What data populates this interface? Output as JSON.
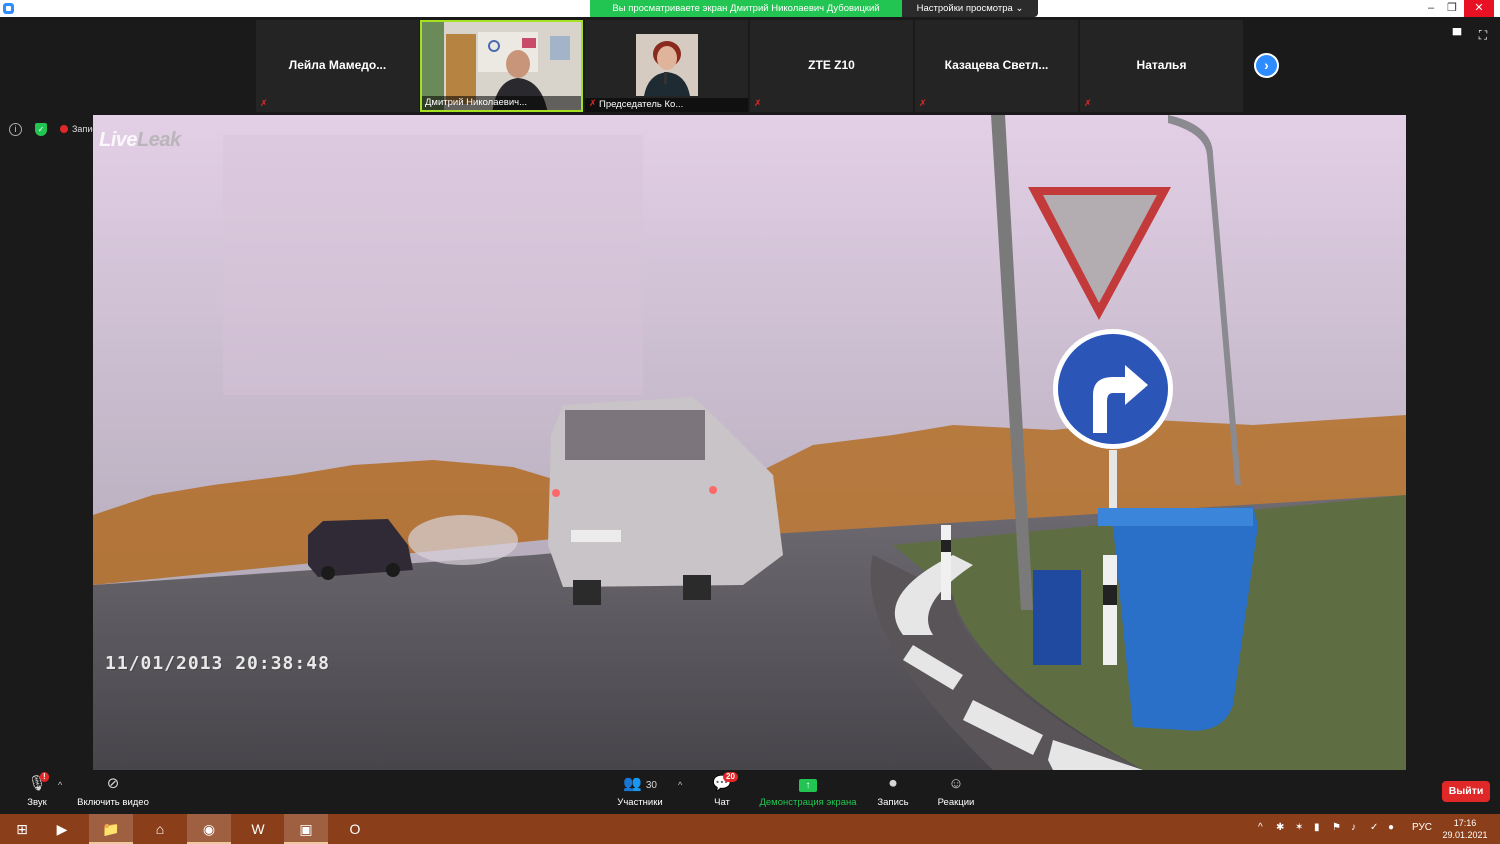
{
  "titlebar": {
    "share_banner": "Вы просматриваете экран Дмитрий Николаевич Дубовицкий",
    "view_settings": "Настройки просмотра ⌄",
    "minimize": "–",
    "restore": "❐",
    "close": "✕"
  },
  "participants": [
    {
      "name": "Лейла  Мамедо...",
      "video": false,
      "muted": true
    },
    {
      "name": "Дмитрий Николаевич...",
      "video": true,
      "muted": false,
      "active_speaker": true
    },
    {
      "name": "Председатель Ко...",
      "video": true,
      "muted": true
    },
    {
      "name": "ZTE Z10",
      "video": false,
      "muted": true
    },
    {
      "name": "Казацева  Светл...",
      "video": false,
      "muted": true
    },
    {
      "name": "Наталья",
      "video": false,
      "muted": true
    }
  ],
  "side_indicators": {
    "info": "i",
    "recording_label": "Запись"
  },
  "shared_screen": {
    "watermark_live": "Live",
    "watermark_leak": "Leak",
    "timestamp": "11/01/2013  20:38:48"
  },
  "toolbar": {
    "audio_label": "Звук",
    "audio_badge": "!",
    "video_label": "Включить видео",
    "participants_label": "Участники",
    "participants_count": "30",
    "chat_label": "Чат",
    "chat_badge": "20",
    "share_label": "Демонстрация экрана",
    "record_label": "Запись",
    "reactions_label": "Реакции",
    "leave_label": "Выйти"
  },
  "taskbar": {
    "language": "РУС",
    "time": "17:16",
    "date": "29.01.2021"
  },
  "colors": {
    "accent_green": "#23c552",
    "accent_blue": "#2d8cff",
    "danger_red": "#e02828",
    "taskbar": "#8a3e19"
  }
}
